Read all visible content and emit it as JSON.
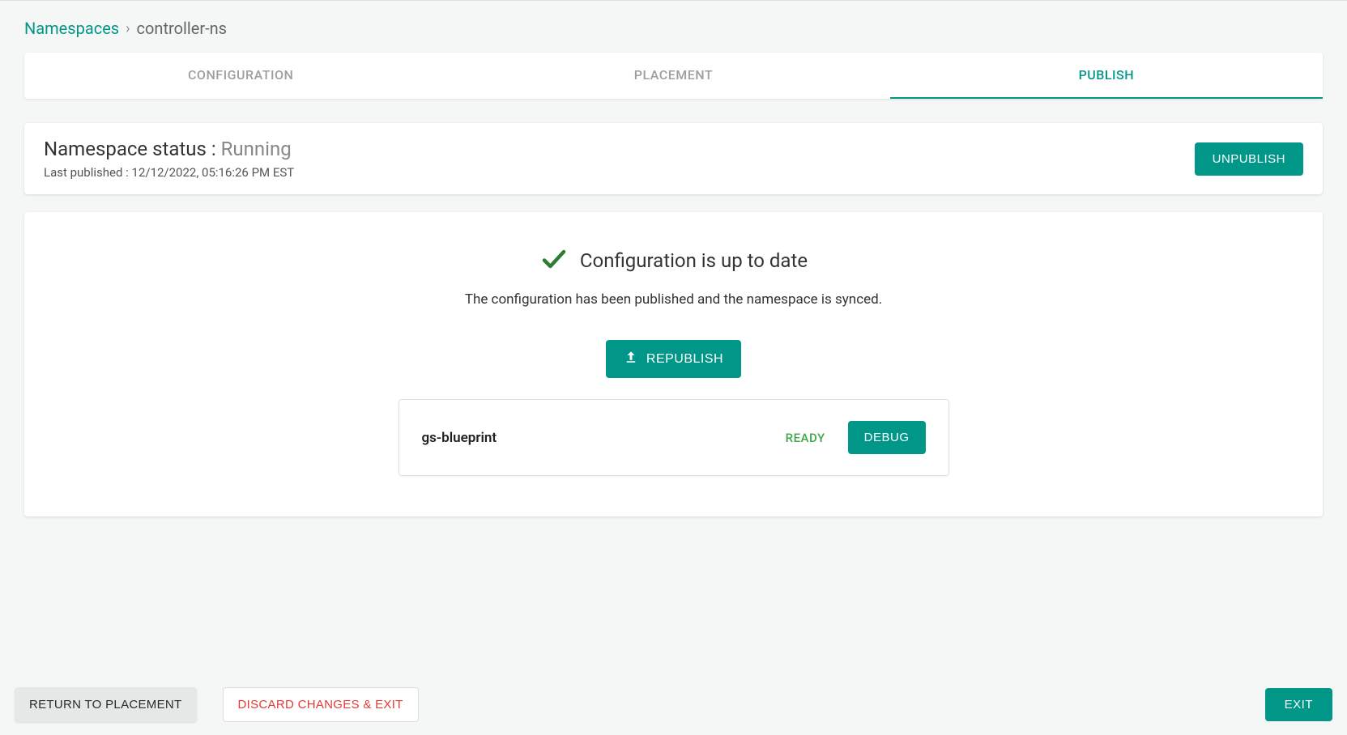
{
  "breadcrumb": {
    "root_label": "Namespaces",
    "separator": "›",
    "current": "controller-ns"
  },
  "tabs": {
    "configuration": "CONFIGURATION",
    "placement": "PLACEMENT",
    "publish": "PUBLISH"
  },
  "status": {
    "label": "Namespace status : ",
    "value": "Running",
    "last_published_label": "Last published : ",
    "last_published_value": "12/12/2022, 05:16:26 PM EST",
    "unpublish_button": "UNPUBLISH"
  },
  "config": {
    "heading": "Configuration is up to date",
    "subtext": "The configuration has been published and the namespace is synced.",
    "republish_button": "REPUBLISH"
  },
  "blueprint": {
    "name": "gs-blueprint",
    "status": "READY",
    "debug_button": "DEBUG"
  },
  "footer": {
    "return_button": "RETURN TO PLACEMENT",
    "discard_button": "DISCARD CHANGES & EXIT",
    "exit_button": "EXIT"
  }
}
